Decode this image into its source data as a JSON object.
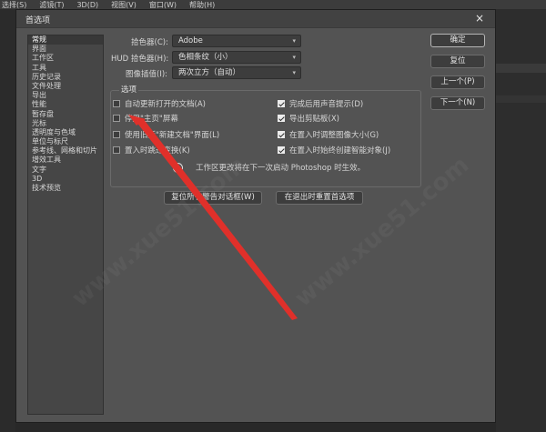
{
  "menubar": {
    "items": [
      "选择(S)",
      "滤镜(T)",
      "3D(D)",
      "视图(V)",
      "窗口(W)",
      "帮助(H)"
    ]
  },
  "dialog": {
    "title": "首选项",
    "close_glyph": "×"
  },
  "sidebar": {
    "items": [
      {
        "label": "常规",
        "selected": true
      },
      {
        "label": "界面"
      },
      {
        "label": "工作区"
      },
      {
        "label": "工具"
      },
      {
        "label": "历史记录"
      },
      {
        "label": "文件处理"
      },
      {
        "label": "导出"
      },
      {
        "label": "性能"
      },
      {
        "label": "暂存盘"
      },
      {
        "label": "光标"
      },
      {
        "label": "透明度与色域"
      },
      {
        "label": "单位与标尺"
      },
      {
        "label": "参考线、网格和切片"
      },
      {
        "label": "增效工具"
      },
      {
        "label": "文字"
      },
      {
        "label": "3D"
      },
      {
        "label": "技术预览"
      }
    ]
  },
  "general": {
    "color_picker_label": "拾色器(C):",
    "color_picker_value": "Adobe",
    "hud_label": "HUD 拾色器(H):",
    "hud_value": "色相条纹（小）",
    "interp_label": "图像插值(I):",
    "interp_value": "两次立方（自动）"
  },
  "options": {
    "title": "选项",
    "left": [
      {
        "label": "自动更新打开的文档(A)",
        "checked": false
      },
      {
        "label": "停用\"主页\"屏幕",
        "checked": false
      },
      {
        "label": "使用旧版\"新建文档\"界面(L)",
        "checked": false
      },
      {
        "label": "置入时跳过变换(K)",
        "checked": false
      }
    ],
    "right": [
      {
        "label": "完成后用声音提示(D)",
        "checked": true
      },
      {
        "label": "导出剪贴板(X)",
        "checked": true
      },
      {
        "label": "在置入时调整图像大小(G)",
        "checked": true
      },
      {
        "label": "在置入时始终创建智能对象(J)",
        "checked": true
      }
    ],
    "info_text": "工作区更改将在下一次启动 Photoshop 时生效。"
  },
  "bottom_buttons": {
    "reset_warnings": "复位所有警告对话框(W)",
    "reset_on_quit": "在退出时重置首选项"
  },
  "right_buttons": {
    "ok": "确定",
    "reset": "复位",
    "prev": "上一个(P)",
    "next": "下一个(N)"
  },
  "watermark_text": "www.xue51.com",
  "colors": {
    "dialog_bg": "#535353",
    "arrow": "#e0302a"
  }
}
